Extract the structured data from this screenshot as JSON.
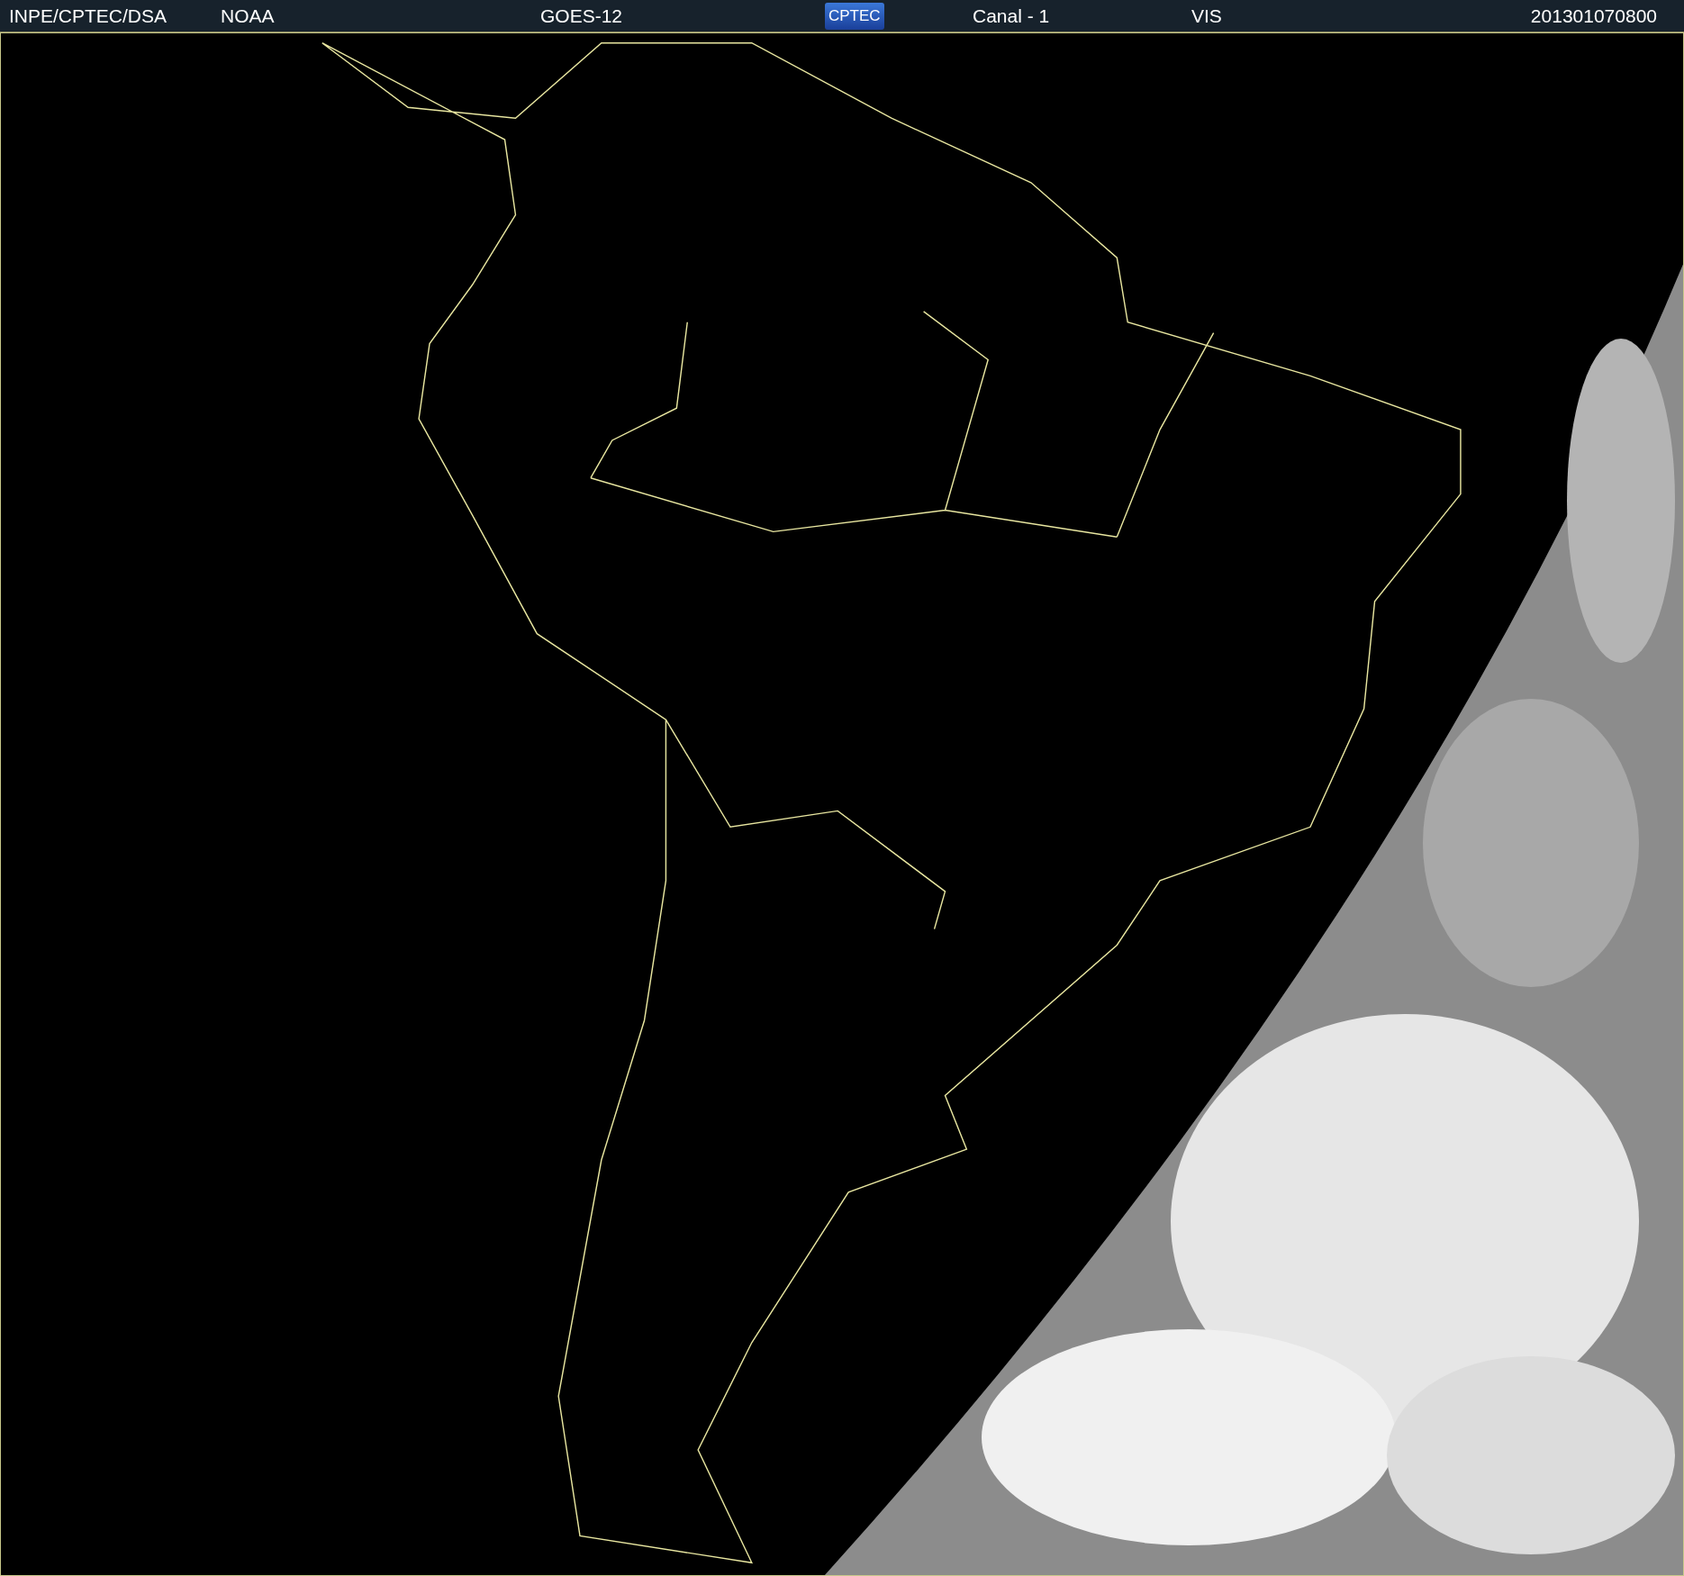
{
  "header": {
    "source": "INPE/CPTEC/DSA",
    "agency": "NOAA",
    "satellite": "GOES-12",
    "logo": "CPTEC",
    "channel": "Canal - 1",
    "band": "VIS",
    "timestamp": "201301070800"
  }
}
